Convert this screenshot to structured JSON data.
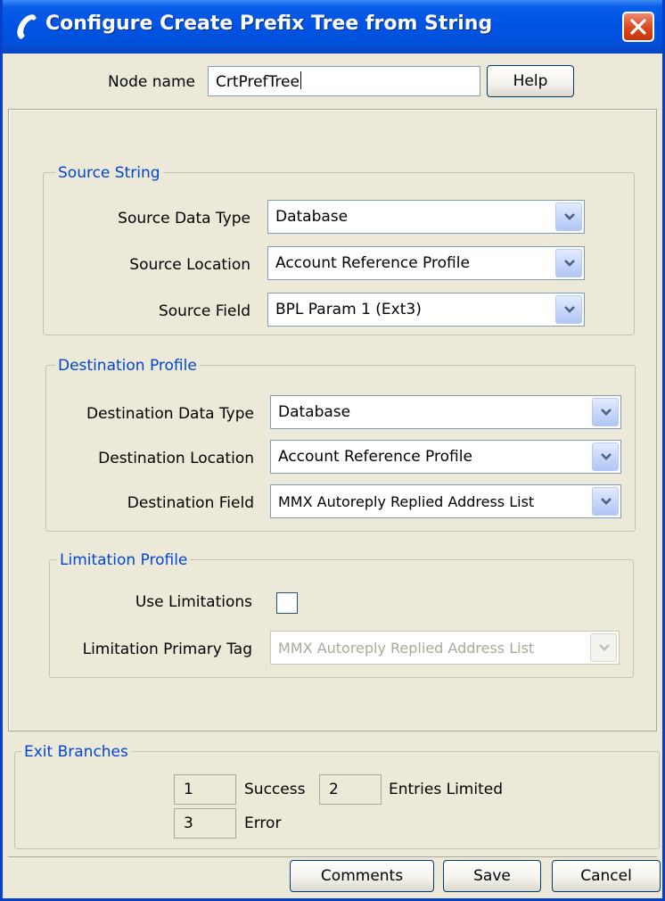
{
  "window": {
    "title": "Configure Create Prefix Tree from String"
  },
  "header": {
    "node_name_label": "Node name",
    "node_name_value": "CrtPrefTree",
    "help_label": "Help"
  },
  "source_string": {
    "group_title": "Source String",
    "data_type_label": "Source Data Type",
    "data_type_value": "Database",
    "location_label": "Source Location",
    "location_value": "Account Reference Profile",
    "field_label": "Source Field",
    "field_value": "BPL Param 1 (Ext3)"
  },
  "destination_profile": {
    "group_title": "Destination Profile",
    "data_type_label": "Destination Data Type",
    "data_type_value": "Database",
    "location_label": "Destination Location",
    "location_value": "Account Reference Profile",
    "field_label": "Destination Field",
    "field_value": "MMX Autoreply Replied Address List"
  },
  "limitation_profile": {
    "group_title": "Limitation Profile",
    "use_limitations_label": "Use Limitations",
    "use_limitations_checked": false,
    "primary_tag_label": "Limitation Primary Tag",
    "primary_tag_value": "MMX Autoreply Replied Address List",
    "primary_tag_disabled": true
  },
  "exit_branches": {
    "group_title": "Exit Branches",
    "items": [
      {
        "number": "1",
        "label": "Success"
      },
      {
        "number": "2",
        "label": "Entries Limited"
      },
      {
        "number": "3",
        "label": "Error"
      }
    ]
  },
  "footer": {
    "comments_label": "Comments",
    "save_label": "Save",
    "cancel_label": "Cancel"
  },
  "icons": {
    "title_icon": "phone-handset-icon",
    "close": "close-icon",
    "dropdown": "chevron-down-icon"
  },
  "colors": {
    "titlebar": "#0054e3",
    "group_title": "#0046d5",
    "close_button": "#d8471f",
    "dialog_background": "#ece9d8"
  }
}
